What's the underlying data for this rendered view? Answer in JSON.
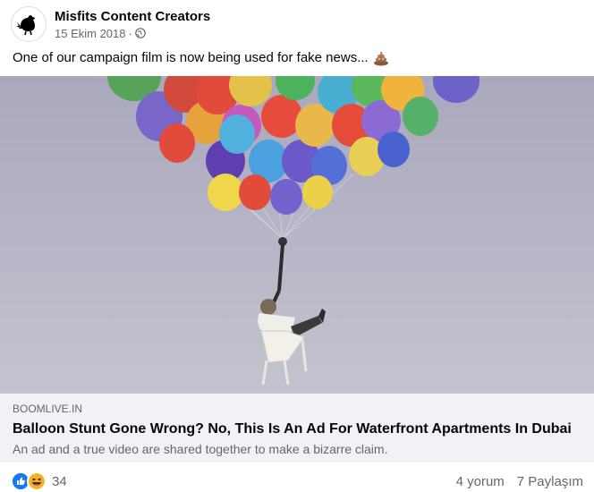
{
  "post": {
    "page_name": "Misfits Content Creators",
    "timestamp": "15 Ekim 2018",
    "separator": "·",
    "audience_icon": "globe-icon",
    "caption": "One of our campaign film is now being used for fake news...",
    "caption_emoji": "poop-emoji"
  },
  "image": {
    "description_icon": "balloon-chair-photo",
    "sky_color": "#b7b6c8"
  },
  "link_preview": {
    "domain": "BOOMLIVE.IN",
    "title": "Balloon Stunt Gone Wrong? No, This Is An Ad For Waterfront Apartments In Dubai",
    "description": "An ad and a true video are shared together to make a bizarre claim."
  },
  "footer": {
    "reaction_icons": [
      "like-icon",
      "haha-icon"
    ],
    "reaction_count": "34",
    "comments": "4 yorum",
    "shares": "7 Paylaşım"
  },
  "colors": {
    "like_blue": "#1877f2",
    "haha_yellow": "#f7b125",
    "secondary_text": "#65676b",
    "link_bg": "#f0f2f5"
  }
}
